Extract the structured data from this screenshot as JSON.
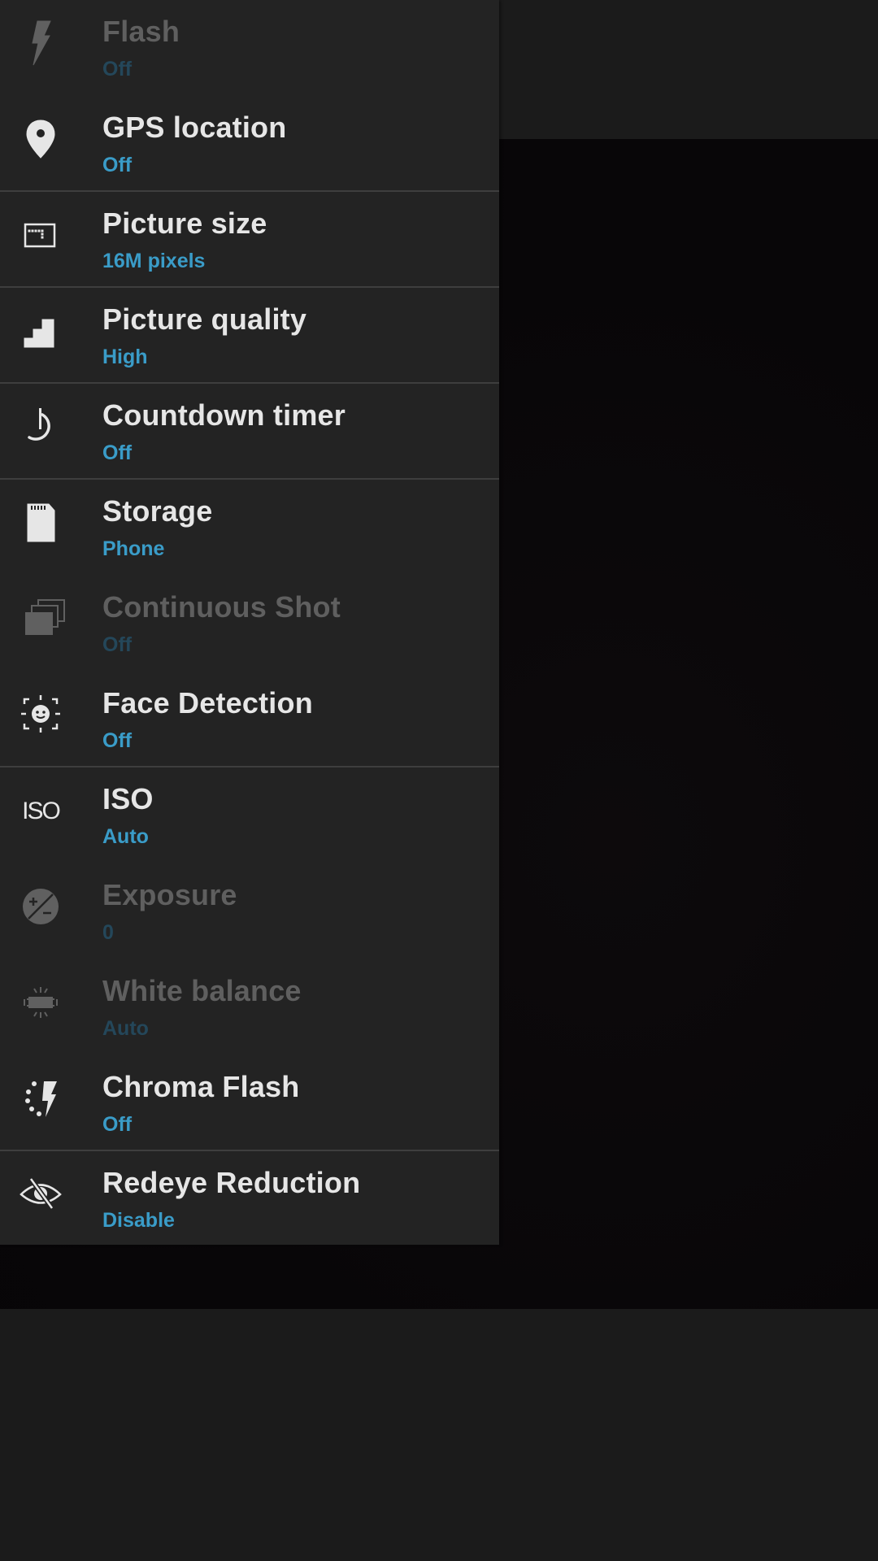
{
  "screen": {
    "accent_color": "#3a9cc8",
    "menu_background": "#232323",
    "disabled_title_color": "#5f5f5f",
    "disabled_value_color": "#24475a"
  },
  "settings_menu": {
    "items": [
      {
        "id": "flash",
        "icon": "flash-icon",
        "title": "Flash",
        "value": "Off",
        "enabled": false,
        "divider_below": false
      },
      {
        "id": "gps-location",
        "icon": "location-pin-icon",
        "title": "GPS location",
        "value": "Off",
        "enabled": true,
        "divider_below": true
      },
      {
        "id": "picture-size",
        "icon": "picture-size-icon",
        "title": "Picture size",
        "value": "16M pixels",
        "enabled": true,
        "divider_below": true
      },
      {
        "id": "picture-quality",
        "icon": "quality-steps-icon",
        "title": "Picture quality",
        "value": "High",
        "enabled": true,
        "divider_below": true
      },
      {
        "id": "countdown-timer",
        "icon": "timer-icon",
        "title": "Countdown timer",
        "value": "Off",
        "enabled": true,
        "divider_below": true
      },
      {
        "id": "storage",
        "icon": "sd-card-icon",
        "title": "Storage",
        "value": "Phone",
        "enabled": true,
        "divider_below": false
      },
      {
        "id": "continuous-shot",
        "icon": "burst-icon",
        "title": "Continuous Shot",
        "value": "Off",
        "enabled": false,
        "divider_below": false
      },
      {
        "id": "face-detection",
        "icon": "face-detection-icon",
        "title": "Face Detection",
        "value": "Off",
        "enabled": true,
        "divider_below": true
      },
      {
        "id": "iso",
        "icon": "iso-icon",
        "title": "ISO",
        "value": "Auto",
        "enabled": true,
        "divider_below": false
      },
      {
        "id": "exposure",
        "icon": "exposure-icon",
        "title": "Exposure",
        "value": "0",
        "enabled": false,
        "divider_below": false
      },
      {
        "id": "white-balance",
        "icon": "white-balance-icon",
        "title": "White balance",
        "value": "Auto",
        "enabled": false,
        "divider_below": false
      },
      {
        "id": "chroma-flash",
        "icon": "chroma-flash-icon",
        "title": "Chroma Flash",
        "value": "Off",
        "enabled": true,
        "divider_below": true
      },
      {
        "id": "redeye-reduction",
        "icon": "redeye-off-icon",
        "title": "Redeye Reduction",
        "value": "Disable",
        "enabled": true,
        "divider_below": false
      }
    ],
    "iso_icon_text": "ISO"
  }
}
